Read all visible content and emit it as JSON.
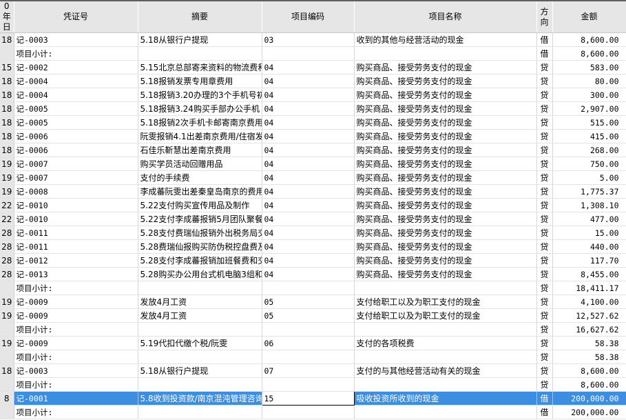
{
  "columns": [
    {
      "key": "day",
      "label": "0年\n日"
    },
    {
      "key": "voucher",
      "label": "凭证号"
    },
    {
      "key": "summary",
      "label": "摘要"
    },
    {
      "key": "code",
      "label": "项目编码"
    },
    {
      "key": "name",
      "label": "项目名称"
    },
    {
      "key": "dir",
      "label": "方\n向"
    },
    {
      "key": "amount",
      "label": "金额"
    }
  ],
  "rows": [
    {
      "day": "18",
      "voucher": "记-0003",
      "summary": "5.18从银行户提现",
      "code": "03",
      "name": "收到的其他与经营活动的现金",
      "dir": "借",
      "amount": "8,600.00"
    },
    {
      "day": "",
      "voucher": "项目小计:",
      "summary": "",
      "code": "",
      "name": "",
      "dir": "借",
      "amount": "8,600.00",
      "type": "subtotal"
    },
    {
      "day": "15",
      "voucher": "记-0002",
      "summary": "5.15北京总部寄来资料的物流费和",
      "code": "04",
      "name": "购买商品、接受劳务支付的现金",
      "dir": "贷",
      "amount": "583.00"
    },
    {
      "day": "18",
      "voucher": "记-0004",
      "summary": "5.18报销发票专用章费用",
      "code": "04",
      "name": "购买商品、接受劳务支付的现金",
      "dir": "贷",
      "amount": "80.00"
    },
    {
      "day": "18",
      "voucher": "记-0004",
      "summary": "5.18报销3.20办理的3个手机号初",
      "code": "04",
      "name": "购买商品、接受劳务支付的现金",
      "dir": "贷",
      "amount": "300.00"
    },
    {
      "day": "18",
      "voucher": "记-0005",
      "summary": "5.18报销3.24购买手部办公手机",
      "code": "04",
      "name": "购买商品、接受劳务支付的现金",
      "dir": "贷",
      "amount": "2,907.00"
    },
    {
      "day": "18",
      "voucher": "记-0005",
      "summary": "5.18报销2次手机卡邮寄南京费用",
      "code": "04",
      "name": "购买商品、接受劳务支付的现金",
      "dir": "贷",
      "amount": "515.00"
    },
    {
      "day": "18",
      "voucher": "记-0006",
      "summary": "阮雯报销4.1出差南京费用/住宿发",
      "code": "04",
      "name": "购买商品、接受劳务支付的现金",
      "dir": "贷",
      "amount": "415.00"
    },
    {
      "day": "18",
      "voucher": "记-0006",
      "summary": "石佳乐靳慧出差南京费用",
      "code": "04",
      "name": "购买商品、接受劳务支付的现金",
      "dir": "贷",
      "amount": "268.00"
    },
    {
      "day": "19",
      "voucher": "记-0007",
      "summary": "购买学员活动回赠用品",
      "code": "04",
      "name": "购买商品、接受劳务支付的现金",
      "dir": "贷",
      "amount": "750.00"
    },
    {
      "day": "19",
      "voucher": "记-0007",
      "summary": "支付的手续费",
      "code": "04",
      "name": "购买商品、接受劳务支付的现金",
      "dir": "贷",
      "amount": "5.00"
    },
    {
      "day": "19",
      "voucher": "记-0008",
      "summary": "李成蕃阮雯出差秦皇岛南京的费用",
      "code": "04",
      "name": "购买商品、接受劳务支付的现金",
      "dir": "贷",
      "amount": "1,775.37"
    },
    {
      "day": "22",
      "voucher": "记-0010",
      "summary": "5.22支付购买宣传用品及制作",
      "code": "04",
      "name": "购买商品、接受劳务支付的现金",
      "dir": "贷",
      "amount": "1,308.10"
    },
    {
      "day": "22",
      "voucher": "记-0010",
      "summary": "5.22支付李成蕃报销5月团队聚餐费",
      "code": "04",
      "name": "购买商品、接受劳务支付的现金",
      "dir": "贷",
      "amount": "477.00"
    },
    {
      "day": "28",
      "voucher": "记-0011",
      "summary": "5.28支付费瑞仙报销外出税务局交",
      "code": "04",
      "name": "购买商品、接受劳务支付的现金",
      "dir": "贷",
      "amount": "15.00"
    },
    {
      "day": "28",
      "voucher": "记-0011",
      "summary": "5.28费瑞仙报购买防伪税控盘费及",
      "code": "04",
      "name": "购买商品、接受劳务支付的现金",
      "dir": "贷",
      "amount": "440.00"
    },
    {
      "day": "28",
      "voucher": "记-0012",
      "summary": "5.28支付李成蕃报销加班餐费和交",
      "code": "04",
      "name": "购买商品、接受劳务支付的现金",
      "dir": "贷",
      "amount": "117.70"
    },
    {
      "day": "28",
      "voucher": "记-0013",
      "summary": "5.28购买办公用台式机电脑3组和",
      "code": "04",
      "name": "购买商品、接受劳务支付的现金",
      "dir": "贷",
      "amount": "8,455.00"
    },
    {
      "day": "",
      "voucher": "项目小计:",
      "summary": "",
      "code": "",
      "name": "",
      "dir": "贷",
      "amount": "18,411.17",
      "type": "subtotal"
    },
    {
      "day": "19",
      "voucher": "记-0009",
      "summary": "发放4月工资",
      "code": "05",
      "name": "支付给职工以及为职工支付的现金",
      "dir": "贷",
      "amount": "4,100.00"
    },
    {
      "day": "19",
      "voucher": "记-0009",
      "summary": "发放4月工资",
      "code": "05",
      "name": "支付给职工以及为职工支付的现金",
      "dir": "贷",
      "amount": "12,527.62"
    },
    {
      "day": "",
      "voucher": "项目小计:",
      "summary": "",
      "code": "",
      "name": "",
      "dir": "贷",
      "amount": "16,627.62",
      "type": "subtotal"
    },
    {
      "day": "19",
      "voucher": "记-0009",
      "summary": "5.19代扣代缴个税/阮雯",
      "code": "06",
      "name": "支付的各项税费",
      "dir": "贷",
      "amount": "58.38"
    },
    {
      "day": "",
      "voucher": "项目小计:",
      "summary": "",
      "code": "",
      "name": "",
      "dir": "贷",
      "amount": "58.38",
      "type": "subtotal"
    },
    {
      "day": "18",
      "voucher": "记-0003",
      "summary": "5.18从银行户提现",
      "code": "07",
      "name": "支付的与其他经营活动有关的现金",
      "dir": "贷",
      "amount": "8,600.00"
    },
    {
      "day": "",
      "voucher": "项目小计:",
      "summary": "",
      "code": "",
      "name": "",
      "dir": "贷",
      "amount": "8,600.00",
      "type": "subtotal"
    },
    {
      "day": "8",
      "voucher": "记-0001",
      "summary": "5.8收到投资款/南京混沌管理咨询",
      "code": "15",
      "name": "吸收投资所收到的现金",
      "dir": "借",
      "amount": "200,000.00",
      "type": "selected"
    },
    {
      "day": "",
      "voucher": "项目小计:",
      "summary": "",
      "code": "",
      "name": "",
      "dir": "借",
      "amount": "200,000.00",
      "type": "subtotal"
    }
  ]
}
